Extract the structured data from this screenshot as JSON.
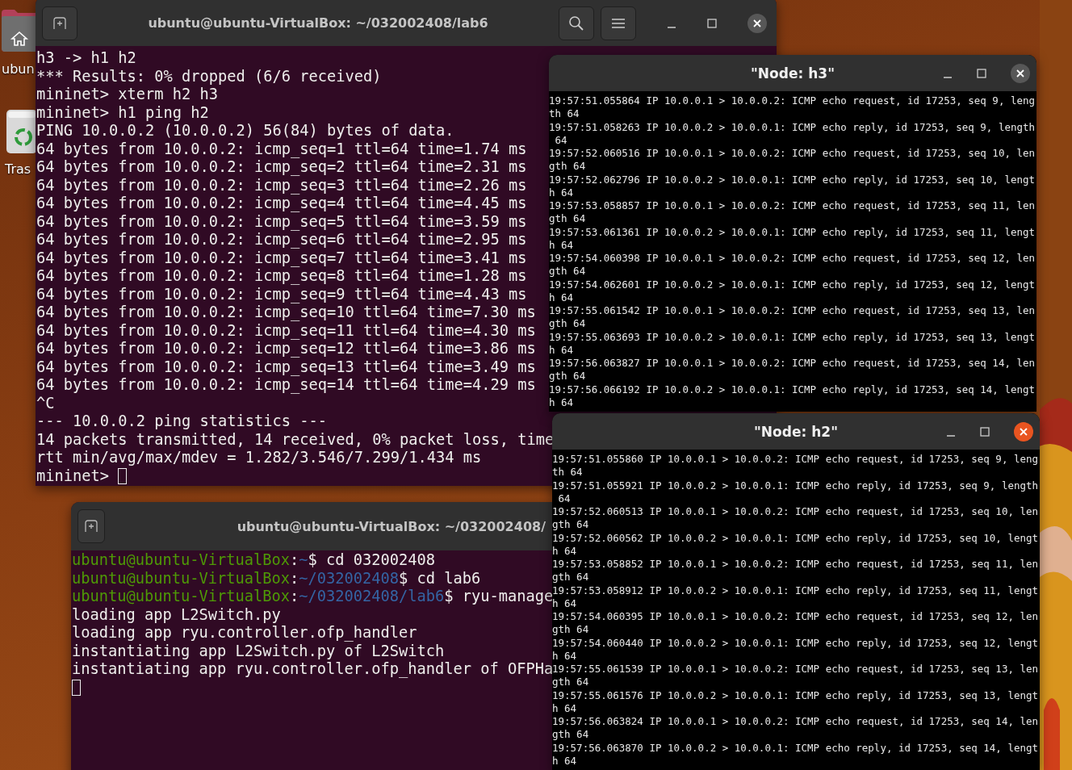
{
  "desktop": {
    "icons": [
      {
        "kind": "home",
        "label": "ubun"
      },
      {
        "kind": "trash",
        "label": "Tras"
      }
    ]
  },
  "main_terminal": {
    "title": "ubuntu@ubuntu-VirtualBox: ~/032002408/lab6",
    "cursor_on_new_line": false,
    "lines": [
      "h3 -> h1 h2",
      "*** Results: 0% dropped (6/6 received)",
      "mininet> xterm h2 h3",
      "mininet> h1 ping h2",
      "PING 10.0.0.2 (10.0.0.2) 56(84) bytes of data.",
      "64 bytes from 10.0.0.2: icmp_seq=1 ttl=64 time=1.74 ms",
      "64 bytes from 10.0.0.2: icmp_seq=2 ttl=64 time=2.31 ms",
      "64 bytes from 10.0.0.2: icmp_seq=3 ttl=64 time=2.26 ms",
      "64 bytes from 10.0.0.2: icmp_seq=4 ttl=64 time=4.45 ms",
      "64 bytes from 10.0.0.2: icmp_seq=5 ttl=64 time=3.59 ms",
      "64 bytes from 10.0.0.2: icmp_seq=6 ttl=64 time=2.95 ms",
      "64 bytes from 10.0.0.2: icmp_seq=7 ttl=64 time=3.41 ms",
      "64 bytes from 10.0.0.2: icmp_seq=8 ttl=64 time=1.28 ms",
      "64 bytes from 10.0.0.2: icmp_seq=9 ttl=64 time=4.43 ms",
      "64 bytes from 10.0.0.2: icmp_seq=10 ttl=64 time=7.30 ms",
      "64 bytes from 10.0.0.2: icmp_seq=11 ttl=64 time=4.30 ms",
      "64 bytes from 10.0.0.2: icmp_seq=12 ttl=64 time=3.86 ms",
      "64 bytes from 10.0.0.2: icmp_seq=13 ttl=64 time=3.49 ms",
      "64 bytes from 10.0.0.2: icmp_seq=14 ttl=64 time=4.29 ms",
      "^C",
      "--- 10.0.0.2 ping statistics ---",
      "14 packets transmitted, 14 received, 0% packet loss, time",
      "rtt min/avg/max/mdev = 1.282/3.546/7.299/1.434 ms",
      "mininet>"
    ]
  },
  "xterm_windows": [
    {
      "title": "\"Node: h3\"",
      "focused": false,
      "lines": [
        "19:57:51.055864 IP 10.0.0.1 > 10.0.0.2: ICMP echo request, id 17253, seq 9, leng",
        "th 64",
        "19:57:51.058263 IP 10.0.0.2 > 10.0.0.1: ICMP echo reply, id 17253, seq 9, length",
        " 64",
        "19:57:52.060516 IP 10.0.0.1 > 10.0.0.2: ICMP echo request, id 17253, seq 10, len",
        "gth 64",
        "19:57:52.062796 IP 10.0.0.2 > 10.0.0.1: ICMP echo reply, id 17253, seq 10, lengt",
        "h 64",
        "19:57:53.058857 IP 10.0.0.1 > 10.0.0.2: ICMP echo request, id 17253, seq 11, len",
        "gth 64",
        "19:57:53.061361 IP 10.0.0.2 > 10.0.0.1: ICMP echo reply, id 17253, seq 11, lengt",
        "h 64",
        "19:57:54.060398 IP 10.0.0.1 > 10.0.0.2: ICMP echo request, id 17253, seq 12, len",
        "gth 64",
        "19:57:54.062601 IP 10.0.0.2 > 10.0.0.1: ICMP echo reply, id 17253, seq 12, lengt",
        "h 64",
        "19:57:55.061542 IP 10.0.0.1 > 10.0.0.2: ICMP echo request, id 17253, seq 13, len",
        "gth 64",
        "19:57:55.063693 IP 10.0.0.2 > 10.0.0.1: ICMP echo reply, id 17253, seq 13, lengt",
        "h 64",
        "19:57:56.063827 IP 10.0.0.1 > 10.0.0.2: ICMP echo request, id 17253, seq 14, len",
        "gth 64",
        "19:57:56.066192 IP 10.0.0.2 > 10.0.0.1: ICMP echo reply, id 17253, seq 14, lengt",
        "h 64"
      ]
    },
    {
      "title": "\"Node: h2\"",
      "focused": true,
      "lines": [
        "19:57:51.055860 IP 10.0.0.1 > 10.0.0.2: ICMP echo request, id 17253, seq 9, leng",
        "th 64",
        "19:57:51.055921 IP 10.0.0.2 > 10.0.0.1: ICMP echo reply, id 17253, seq 9, length",
        " 64",
        "19:57:52.060513 IP 10.0.0.1 > 10.0.0.2: ICMP echo request, id 17253, seq 10, len",
        "gth 64",
        "19:57:52.060562 IP 10.0.0.2 > 10.0.0.1: ICMP echo reply, id 17253, seq 10, lengt",
        "h 64",
        "19:57:53.058852 IP 10.0.0.1 > 10.0.0.2: ICMP echo request, id 17253, seq 11, len",
        "gth 64",
        "19:57:53.058912 IP 10.0.0.2 > 10.0.0.1: ICMP echo reply, id 17253, seq 11, lengt",
        "h 64",
        "19:57:54.060395 IP 10.0.0.1 > 10.0.0.2: ICMP echo request, id 17253, seq 12, len",
        "gth 64",
        "19:57:54.060440 IP 10.0.0.2 > 10.0.0.1: ICMP echo reply, id 17253, seq 12, lengt",
        "h 64",
        "19:57:55.061539 IP 10.0.0.1 > 10.0.0.2: ICMP echo request, id 17253, seq 13, len",
        "gth 64",
        "19:57:55.061576 IP 10.0.0.2 > 10.0.0.1: ICMP echo reply, id 17253, seq 13, lengt",
        "h 64",
        "19:57:56.063824 IP 10.0.0.1 > 10.0.0.2: ICMP echo request, id 17253, seq 14, len",
        "gth 64",
        "19:57:56.063870 IP 10.0.0.2 > 10.0.0.1: ICMP echo reply, id 17253, seq 14, lengt",
        "h 64"
      ]
    }
  ],
  "controller_terminal": {
    "title": "ubuntu@ubuntu-VirtualBox: ~/032002408/",
    "cursor_on_new_line": true,
    "lines": [
      [
        {
          "kind": "user",
          "text": "ubuntu@ubuntu-VirtualBox"
        },
        {
          "kind": "plain",
          "text": ":"
        },
        {
          "kind": "path",
          "text": "~"
        },
        {
          "kind": "plain",
          "text": "$ cd 032002408"
        }
      ],
      [
        {
          "kind": "user",
          "text": "ubuntu@ubuntu-VirtualBox"
        },
        {
          "kind": "plain",
          "text": ":"
        },
        {
          "kind": "path",
          "text": "~/032002408"
        },
        {
          "kind": "plain",
          "text": "$ cd lab6"
        }
      ],
      [
        {
          "kind": "user",
          "text": "ubuntu@ubuntu-VirtualBox"
        },
        {
          "kind": "plain",
          "text": ":"
        },
        {
          "kind": "path",
          "text": "~/032002408/lab6"
        },
        {
          "kind": "plain",
          "text": "$ ryu-manage"
        }
      ],
      [
        {
          "kind": "plain",
          "text": "loading app L2Switch.py"
        }
      ],
      [
        {
          "kind": "plain",
          "text": "loading app ryu.controller.ofp_handler"
        }
      ],
      [
        {
          "kind": "plain",
          "text": "instantiating app L2Switch.py of L2Switch"
        }
      ],
      [
        {
          "kind": "plain",
          "text": "instantiating app ryu.controller.ofp_handler of OFPHa"
        }
      ]
    ]
  }
}
